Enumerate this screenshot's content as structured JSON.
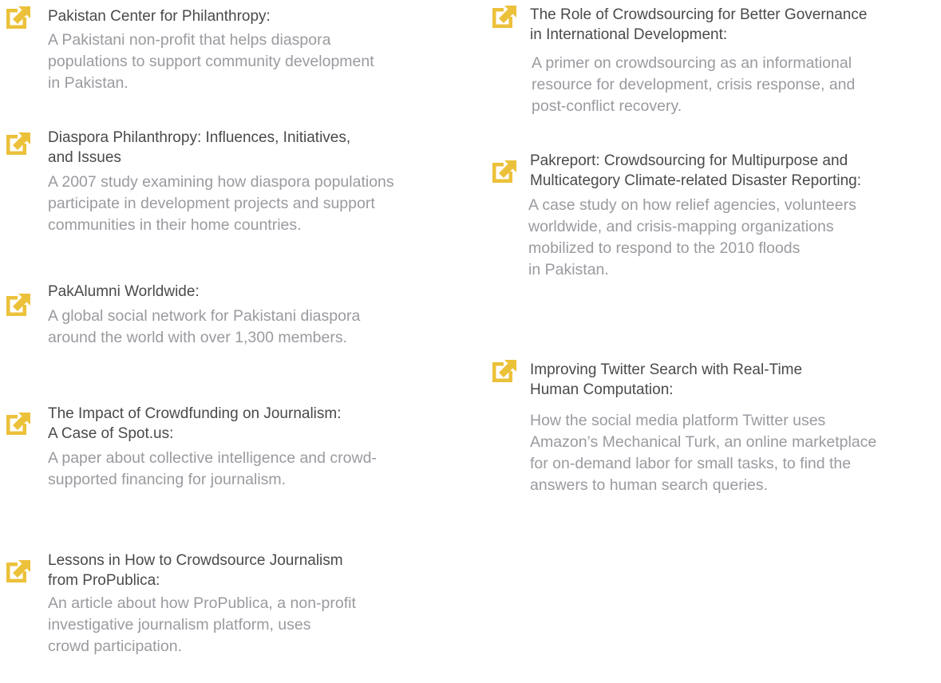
{
  "icon_color": "#ECC13A",
  "left_column": [
    {
      "title": [
        "Pakistan Center for Philanthropy:"
      ],
      "description": [
        "A Pakistani non-profit that helps diaspora",
        "populations to support community development",
        "in Pakistan."
      ]
    },
    {
      "title": [
        "Diaspora Philanthropy: Influences, Initiatives,",
        "and Issues"
      ],
      "description": [
        "A 2007 study examining how diaspora populations",
        "participate in development projects and support",
        "communities in their home countries."
      ]
    },
    {
      "title": [
        "PakAlumni Worldwide:"
      ],
      "description": [
        "A global social network for Pakistani diaspora",
        "around the world with over 1,300 members."
      ]
    },
    {
      "title": [
        "The Impact of Crowdfunding on Journalism:",
        "A Case of Spot.us:"
      ],
      "description": [
        "A paper about collective intelligence and crowd-",
        "supported financing for journalism."
      ]
    },
    {
      "title": [
        "Lessons in How to Crowdsource Journalism",
        "from ProPublica:"
      ],
      "description": [
        "An article about how ProPublica, a non-profit",
        "investigative journalism platform, uses",
        "crowd participation."
      ]
    }
  ],
  "right_column": [
    {
      "title": [
        "The Role of Crowdsourcing for Better Governance",
        "in International Development:"
      ],
      "description": [
        "A primer on crowdsourcing as an informational",
        "resource for development, crisis response, and",
        "post-conflict recovery."
      ]
    },
    {
      "title": [
        "Pakreport: Crowdsourcing for Multipurpose and",
        "Multicategory Climate-related Disaster Reporting:"
      ],
      "description": [
        "A case study on how relief agencies, volunteers",
        "worldwide, and crisis-mapping organizations",
        "mobilized to respond to the 2010 floods",
        "in Pakistan."
      ]
    },
    {
      "title": [
        "Improving Twitter Search with Real-Time",
        "Human Computation:"
      ],
      "description": [
        "How the social media platform Twitter uses",
        "Amazon’s Mechanical Turk, an online marketplace",
        "for on-demand labor for small tasks, to find the",
        "answers to human search queries."
      ]
    }
  ]
}
